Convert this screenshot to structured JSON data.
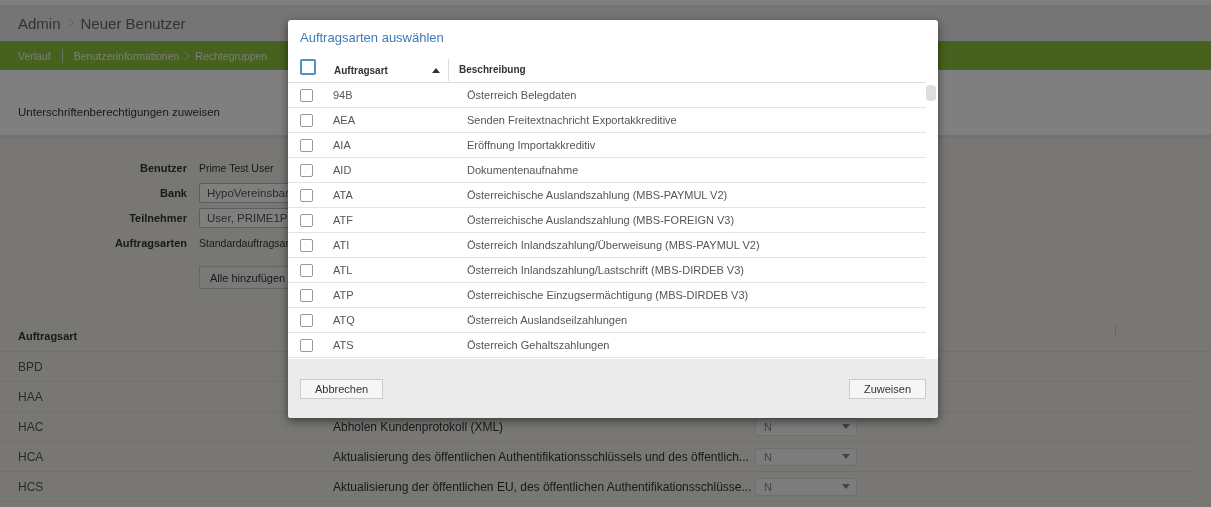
{
  "breadcrumb": {
    "items": [
      "Admin",
      "Neuer Benutzer"
    ]
  },
  "nav": {
    "items": [
      {
        "label": "Verlauf"
      },
      {
        "label": "Benutzerinformationen"
      },
      {
        "label": "Rechtegruppen"
      }
    ]
  },
  "section_title": "Unterschriftenberechtigungen zuweisen",
  "form": {
    "fields": [
      {
        "label": "Benutzer",
        "kind": "text",
        "value": "Prime Test User"
      },
      {
        "label": "Bank",
        "kind": "select",
        "value": "HypoVereinsbar"
      },
      {
        "label": "Teilnehmer",
        "kind": "select",
        "value": "User, PRIME1P"
      },
      {
        "label": "Auftragsarten",
        "kind": "text",
        "value": "Standardauftragsar"
      }
    ],
    "button": "Alle hinzufügen"
  },
  "table": {
    "columns": [
      "Auftragsart"
    ],
    "rows": [
      {
        "code": "BPD"
      },
      {
        "code": "HAA"
      },
      {
        "code": "HAC",
        "description": "Abholen Kundenprotokoll (XML)",
        "value": "N"
      },
      {
        "code": "HCA",
        "description": "Aktualisierung des öffentlichen Authentifikationsschlüssels und des öffentlich...",
        "value": "N"
      },
      {
        "code": "HCS",
        "description": "Aktualisierung der öffentlichen EU, des öffentlichen Authentifikationsschlüsse...",
        "value": "N"
      }
    ]
  },
  "dialog": {
    "title": "Auftragsarten auswählen",
    "select_all": {
      "checked": false
    },
    "columns": [
      "Auftragsart",
      "Beschreibung"
    ],
    "rows": [
      {
        "code": "94B",
        "description": "Österreich Belegdaten",
        "checked": false
      },
      {
        "code": "AEA",
        "description": "Senden Freitextnachricht Exportakkreditive",
        "checked": false
      },
      {
        "code": "AIA",
        "description": "Eröffnung Importakkreditiv",
        "checked": false
      },
      {
        "code": "AID",
        "description": "Dokumentenaufnahme",
        "checked": false
      },
      {
        "code": "ATA",
        "description": "Österreichische Auslandszahlung (MBS-PAYMUL V2)",
        "checked": false
      },
      {
        "code": "ATF",
        "description": "Österreichische Auslandszahlung (MBS-FOREIGN V3)",
        "checked": false
      },
      {
        "code": "ATI",
        "description": "Österreich Inlandszahlung/Überweisung (MBS-PAYMUL V2)",
        "checked": false
      },
      {
        "code": "ATL",
        "description": "Österreich Inlandszahlung/Lastschrift (MBS-DIRDEB V3)",
        "checked": false
      },
      {
        "code": "ATP",
        "description": "Österreichische Einzugsermächtigung (MBS-DIRDEB V3)",
        "checked": false
      },
      {
        "code": "ATQ",
        "description": "Österreich Auslandseilzahlungen",
        "checked": false
      },
      {
        "code": "ATS",
        "description": "Österreich Gehaltszahlungen",
        "checked": false
      }
    ],
    "buttons": {
      "cancel": "Abbrechen",
      "confirm": "Zuweisen"
    }
  }
}
